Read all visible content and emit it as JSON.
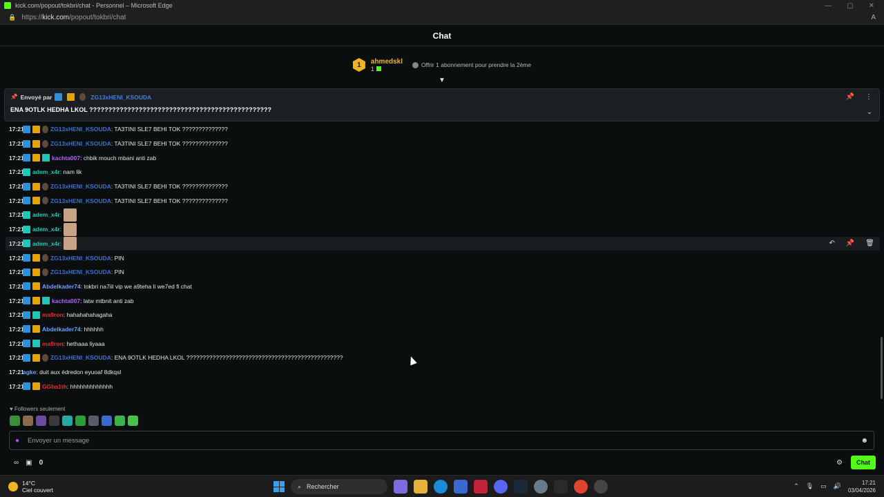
{
  "browser": {
    "title": "kick.com/popout/tokbri/chat - Personnel – Microsoft Edge",
    "url_prefix": "https://",
    "url_host": "kick.com",
    "url_path": "/popout/tokbri/chat"
  },
  "header": {
    "title": "Chat"
  },
  "gifter": {
    "rank": "1",
    "name": "ahmedskl",
    "count": "1",
    "offer": "Offrir 1 abonnement pour prendre la 2ème"
  },
  "pinned": {
    "sent_by": "Envoyé par",
    "user": "ZG13xHENI_KSOUDA",
    "message": "ENA 9OTLK HEDHA LKOL ????????????????????????????????????????????????"
  },
  "messages": [
    {
      "time": "17:21",
      "user": "ZG13xHENI_KSOUDA",
      "text": ": TA3TINI SLE7 BEHI TOK ??????????????"
    },
    {
      "time": "17:21",
      "user": "ZG13xHENI_KSOUDA",
      "text": ": TA3TINI SLE7 BEHI TOK ??????????????"
    },
    {
      "time": "17:21",
      "user": "kachta007",
      "text": ": chbik mouch mbani anti zab"
    },
    {
      "time": "17:21",
      "user": "adem_x4r",
      "text": ": nam lik"
    },
    {
      "time": "17:21",
      "user": "ZG13xHENI_KSOUDA",
      "text": ": TA3TINI SLE7 BEHI TOK ??????????????"
    },
    {
      "time": "17:21",
      "user": "ZG13xHENI_KSOUDA",
      "text": ": TA3TINI SLE7 BEHI TOK ??????????????"
    },
    {
      "time": "17:21",
      "user": "adem_x4r",
      "text": ":"
    },
    {
      "time": "17:21",
      "user": "adem_x4r",
      "text": ":"
    },
    {
      "time": "17:21",
      "user": "adem_x4r",
      "text": ":"
    },
    {
      "time": "17:21",
      "user": "ZG13xHENI_KSOUDA",
      "text": ": PIN"
    },
    {
      "time": "17:21",
      "user": "ZG13xHENI_KSOUDA",
      "text": ": PIN"
    },
    {
      "time": "17:21",
      "user": "Abdelkader74",
      "text": ": tokbri na7iil vip we a9teha li we7ed fi chat"
    },
    {
      "time": "17:21",
      "user": "kachta007",
      "text": ": latw mtbnit anti zab"
    },
    {
      "time": "17:21",
      "user": "ma9ron",
      "text": ": hahahahahagaha"
    },
    {
      "time": "17:21",
      "user": "Abdelkader74",
      "text": ": hhhhhh"
    },
    {
      "time": "17:21",
      "user": "ma9ron",
      "text": ": hethaaa liyaaa"
    },
    {
      "time": "17:21",
      "user": "ZG13xHENI_KSOUDA",
      "text": ": ENA 9OTLK HEDHA LKOL ????????????????????????????????????????????????"
    },
    {
      "time": "17:21",
      "user": "agke",
      "text": ": duit aux édredon eyuoaf 8dkqsl"
    },
    {
      "time": "17:21",
      "user": "GGba1th",
      "text": ": hhhhhhhhhhhhh"
    }
  ],
  "followers_only": "Followers seulement",
  "input": {
    "placeholder": "Envoyer un message"
  },
  "footer": {
    "count": "0",
    "chat_button": "Chat"
  },
  "taskbar": {
    "temp": "14°C",
    "weather": "Ciel couvert",
    "search": "Rechercher",
    "time": "17:21",
    "date": "03/04/2026"
  }
}
